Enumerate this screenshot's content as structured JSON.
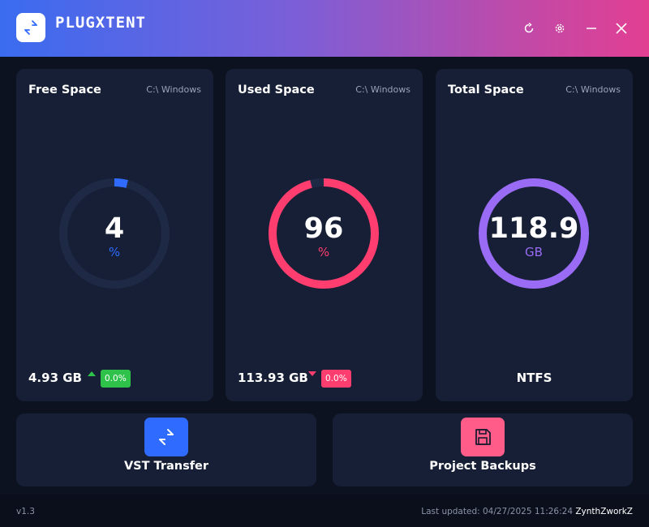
{
  "header": {
    "title": "PLUGXTENT",
    "logo_icon": "transfer-arrows-icon",
    "buttons": [
      {
        "icon": "refresh-icon",
        "label": "↻"
      },
      {
        "icon": "gear-icon",
        "label": "⚙"
      },
      {
        "icon": "minimize-icon",
        "label": "—"
      },
      {
        "icon": "close-icon",
        "label": "✕"
      }
    ],
    "gradient_colors": [
      "#3a6cf0",
      "#7a5fd8",
      "#c04aa8",
      "#e23f92"
    ]
  },
  "cards": {
    "free": {
      "title": "Free Space",
      "path": "C:\\ Windows",
      "value": "4",
      "unit": "%",
      "percent": 4,
      "bottom_value": "4.93 GB",
      "trend": "up",
      "badge": "0.0%",
      "color": "#2f6bff",
      "badge_color": "#2ec24a"
    },
    "used": {
      "title": "Used Space",
      "path": "C:\\ Windows",
      "value": "96",
      "unit": "%",
      "percent": 96,
      "bottom_value": "113.93 GB",
      "trend": "down",
      "badge": "0.0%",
      "color": "#ff3d6e",
      "badge_color": "#ff3d6e"
    },
    "total": {
      "title": "Total Space",
      "path": "C:\\ Windows",
      "value": "118.9",
      "unit": "GB",
      "percent": 100,
      "filesystem": "NTFS",
      "color": "#9a6cf5"
    }
  },
  "actions": {
    "vst": {
      "label": "VST Transfer",
      "icon": "transfer-arrows-icon",
      "color": "#2f6bff"
    },
    "backups": {
      "label": "Project Backups",
      "icon": "floppy-disk-icon",
      "color": "#ff5c8a"
    }
  },
  "footer": {
    "version": "v1.3",
    "updated": "Last updated: 04/27/2025 11:26:24",
    "user": "ZynthZworkZ"
  }
}
